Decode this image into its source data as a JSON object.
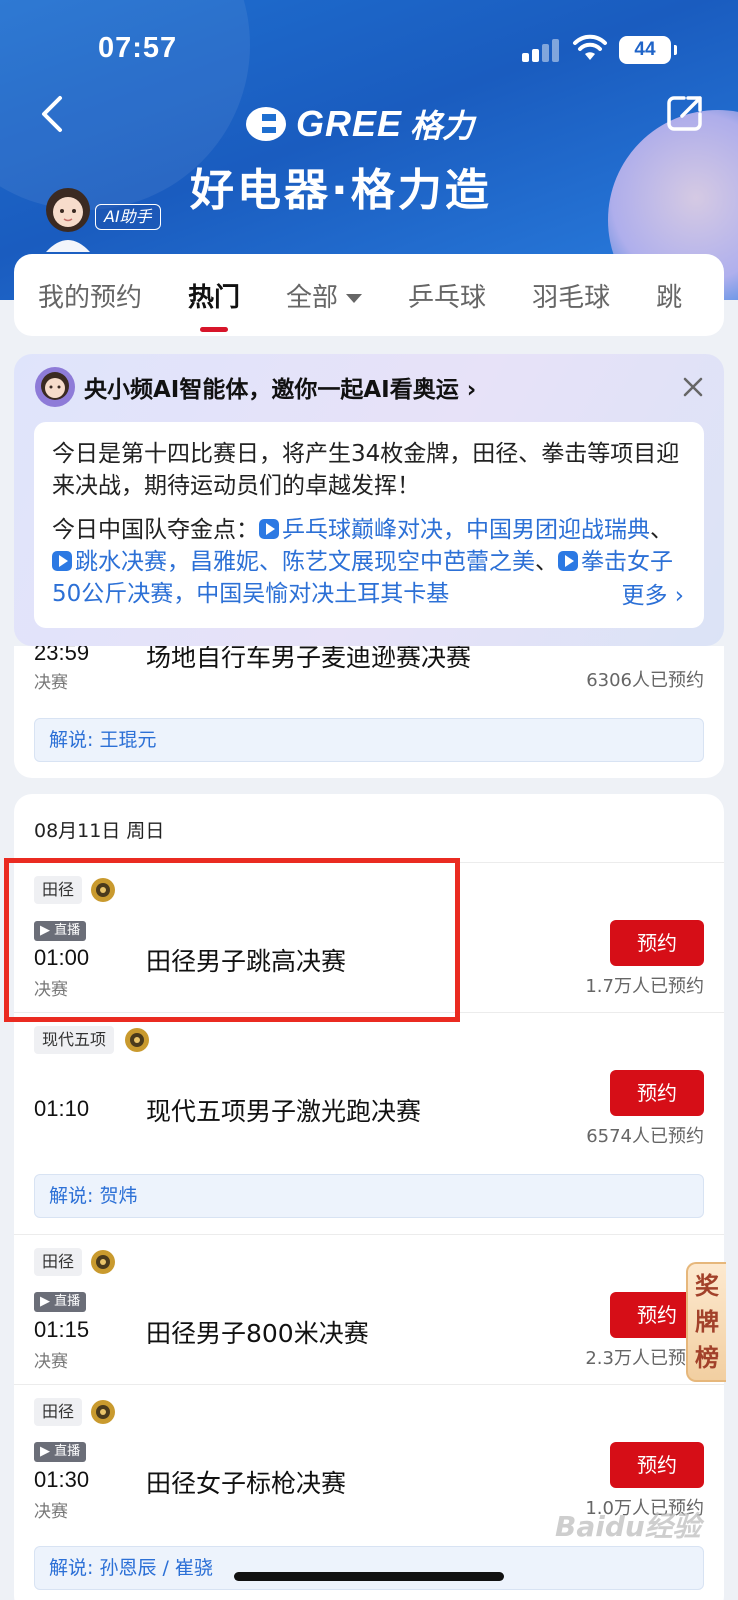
{
  "status_bar": {
    "time": "07:57",
    "battery": "44"
  },
  "header": {
    "brand_en": "GREE",
    "brand_cn": "格力",
    "slogan": "好电器·格力造",
    "ai_tag": "AI助手"
  },
  "tabs": [
    {
      "label": "我的预约"
    },
    {
      "label": "热门"
    },
    {
      "label": "全部"
    },
    {
      "label": "乒乓球"
    },
    {
      "label": "羽毛球"
    },
    {
      "label": "跳"
    }
  ],
  "ai_card": {
    "title": "央小频AI智能体，邀你一起AI看奥运 ›",
    "para1": "今日是第十四比赛日，将产生34枚金牌，田径、拳击等项目迎来决战，期待运动员们的卓越发挥！",
    "para2_prefix": "今日中国队夺金点：",
    "link1": "乒乓球巅峰对决，中国男团迎战瑞典",
    "sep": "、",
    "link2": "跳水决赛，昌雅妮、陈艺文展现空中芭蕾之美",
    "link3": "拳击女子50公斤决赛，中国吴愉对决土耳其卡基",
    "more": "更多 ›"
  },
  "prev_event": {
    "time": "23:59",
    "stage": "决赛",
    "name": "场地自行车男子麦迪逊赛决赛",
    "count": "6306人已预约",
    "commentator": "解说: 王琨元"
  },
  "day": {
    "date": "08月11日 周日",
    "reserve_label": "预约",
    "live_label": "▶ 直播",
    "events": [
      {
        "sport": "田径",
        "live": true,
        "time": "01:00",
        "stage": "决赛",
        "name": "田径男子跳高决赛",
        "count": "1.7万人已预约"
      },
      {
        "sport": "现代五项",
        "live": false,
        "time": "01:10",
        "stage": "",
        "name": "现代五项男子激光跑决赛",
        "count": "6574人已预约",
        "commentator": "解说: 贺炜"
      },
      {
        "sport": "田径",
        "live": true,
        "time": "01:15",
        "stage": "决赛",
        "name": "田径男子800米决赛",
        "count": "2.3万人已预约"
      },
      {
        "sport": "田径",
        "live": true,
        "time": "01:30",
        "stage": "决赛",
        "name": "田径女子标枪决赛",
        "count": "1.0万人已预约",
        "commentator": "解说: 孙恩辰 / 崔骁"
      }
    ]
  },
  "side_button": "奖牌榜",
  "watermark": "Baidu经验",
  "colors": {
    "brand_blue": "#1f6fd0",
    "reserve_red": "#d60e17",
    "link_blue": "#2c70d6",
    "highlight_red": "#ea2b21"
  }
}
